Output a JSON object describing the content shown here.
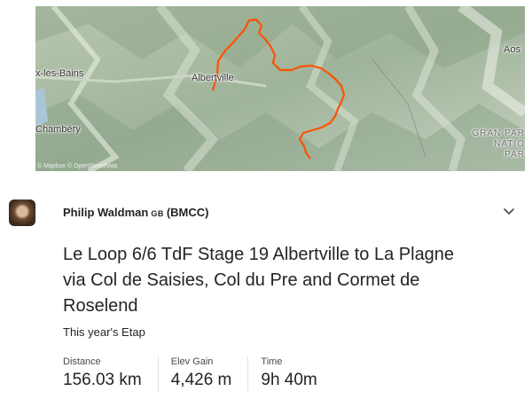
{
  "map": {
    "labels": {
      "aix": "x-les-Bains",
      "albertville": "Albertville",
      "chambery": "Chambéry",
      "aosta": "Aos",
      "park": [
        "GRAN PAR",
        "NATIO",
        "PAR"
      ]
    },
    "attribution": "© Mapbox © OpenStreetMap",
    "route_color": "#fc5200"
  },
  "activity": {
    "athlete": "Philip Waldman",
    "country": "GB",
    "club": "(BMCC)",
    "title": "Le Loop 6/6 TdF Stage 19 Albertville to La Plagne via Col de Saisies, Col du Pre and Cormet de Roselend",
    "description": "This year's Etap",
    "stats": [
      {
        "label": "Distance",
        "value": "156.03 km"
      },
      {
        "label": "Elev Gain",
        "value": "4,426 m"
      },
      {
        "label": "Time",
        "value": "9h 40m"
      }
    ]
  }
}
